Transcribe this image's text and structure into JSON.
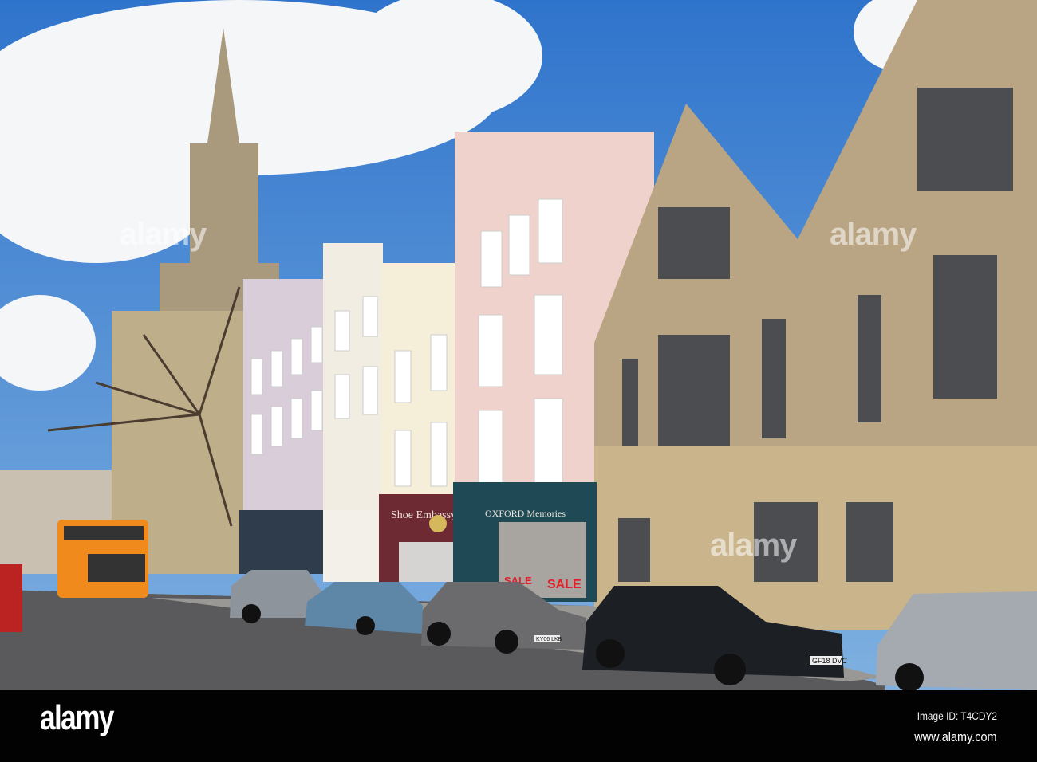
{
  "photo": {
    "shop_signs": [
      "Shoe Embassy",
      "OXFORD Memories"
    ],
    "window_signs": [
      "SALE",
      "SALE"
    ],
    "plates": [
      "GF18 DVC",
      "KY06 LKB"
    ]
  },
  "watermark": {
    "text": "alamy"
  },
  "footer": {
    "logo": "alamy",
    "image_id": "Image ID: T4CDY2",
    "website": "www.alamy.com"
  },
  "colors": {
    "sky": "#3f82d2",
    "bar": "#020202",
    "pink": "#f0d2cc",
    "stone": "#b9a583",
    "bus": "#f08a1c"
  }
}
